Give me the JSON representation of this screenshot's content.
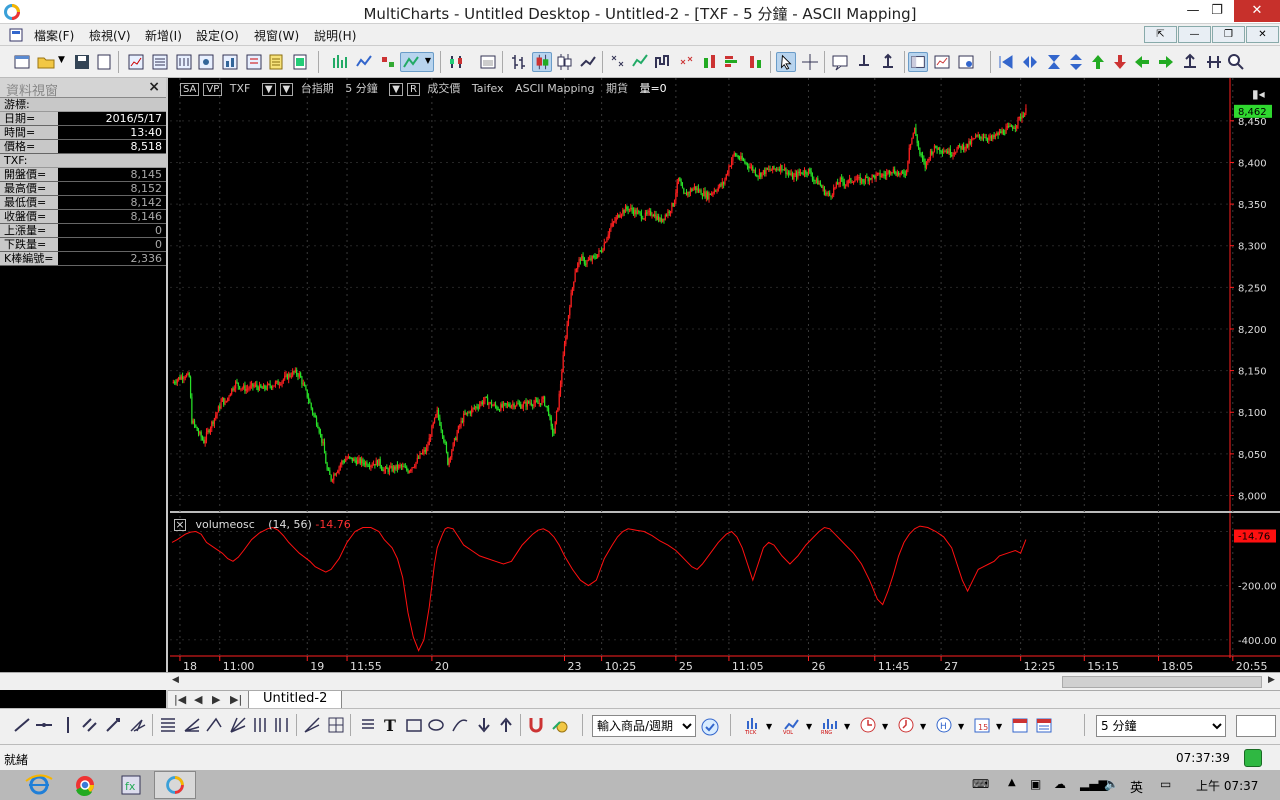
{
  "window": {
    "title": "MultiCharts - Untitled Desktop - Untitled-2 - [TXF - 5 分鐘 - ASCII Mapping]",
    "minimize": "—",
    "maximize": "❐",
    "close": "✕"
  },
  "menu": {
    "items": [
      "檔案(F)",
      "檢視(V)",
      "新增(I)",
      "設定(O)",
      "視窗(W)",
      "說明(H)"
    ]
  },
  "dataview": {
    "title": "資料視窗",
    "close": "×",
    "cursor_group": "游標:",
    "cursor_rows": [
      {
        "k": "日期=",
        "v": "2016/5/17"
      },
      {
        "k": "時間=",
        "v": "13:40"
      },
      {
        "k": "價格=",
        "v": "8,518"
      }
    ],
    "symbol_group": "TXF:",
    "symbol_rows": [
      {
        "k": "開盤價=",
        "v": "8,145"
      },
      {
        "k": "最高價=",
        "v": "8,152"
      },
      {
        "k": "最低價=",
        "v": "8,142"
      },
      {
        "k": "收盤價=",
        "v": "8,146"
      },
      {
        "k": "上漲量=",
        "v": "0"
      },
      {
        "k": "下跌量=",
        "v": "0"
      },
      {
        "k": "K棒編號=",
        "v": "2,336"
      }
    ]
  },
  "chart_header": {
    "sa": "SA",
    "vp": "VP",
    "symbol": "TXF",
    "exchange_name": "台指期",
    "resolution": "5 分鐘",
    "r_label": "R",
    "field": "成交價",
    "source": "Taifex",
    "mapping": "ASCII Mapping",
    "category": "期貨",
    "volume": "量=0"
  },
  "indicator": {
    "close": "×",
    "name": "volumeosc",
    "params": "(14, 56)",
    "value": "-14.76"
  },
  "chart_data": [
    {
      "type": "candlestick",
      "price_axis": {
        "ticks": [
          8000,
          8050,
          8100,
          8150,
          8200,
          8250,
          8300,
          8350,
          8400,
          8450
        ],
        "labels": [
          "8,000",
          "8,050",
          "8,100",
          "8,150",
          "8,200",
          "8,250",
          "8,300",
          "8,350",
          "8,400",
          "8,450"
        ],
        "ylim": [
          7985,
          8475
        ]
      },
      "last_price_label": "8,462",
      "up_color": "#ff2020",
      "down_color": "#28e028",
      "path": [
        [
          0,
          8135
        ],
        [
          4,
          8140
        ],
        [
          10,
          8145
        ],
        [
          13,
          8142
        ],
        [
          15,
          8090
        ],
        [
          20,
          8075
        ],
        [
          24,
          8065
        ],
        [
          28,
          8080
        ],
        [
          34,
          8100
        ],
        [
          38,
          8115
        ],
        [
          40,
          8110
        ],
        [
          44,
          8125
        ],
        [
          48,
          8135
        ],
        [
          52,
          8130
        ],
        [
          56,
          8128
        ],
        [
          62,
          8132
        ],
        [
          68,
          8128
        ],
        [
          74,
          8132
        ],
        [
          80,
          8135
        ],
        [
          86,
          8142
        ],
        [
          92,
          8148
        ],
        [
          96,
          8145
        ],
        [
          102,
          8120
        ],
        [
          106,
          8100
        ],
        [
          110,
          8085
        ],
        [
          114,
          8060
        ],
        [
          117,
          8030
        ],
        [
          120,
          8020
        ],
        [
          124,
          8030
        ],
        [
          128,
          8040
        ],
        [
          132,
          8045
        ],
        [
          138,
          8042
        ],
        [
          144,
          8040
        ],
        [
          150,
          8038
        ],
        [
          156,
          8040
        ],
        [
          160,
          8030
        ],
        [
          166,
          8032
        ],
        [
          172,
          8035
        ],
        [
          178,
          8030
        ],
        [
          184,
          8040
        ],
        [
          188,
          8050
        ],
        [
          192,
          8055
        ],
        [
          196,
          8080
        ],
        [
          200,
          8100
        ],
        [
          204,
          8075
        ],
        [
          206,
          8060
        ],
        [
          208,
          8040
        ],
        [
          212,
          8060
        ],
        [
          216,
          8080
        ],
        [
          220,
          8095
        ],
        [
          224,
          8100
        ],
        [
          228,
          8105
        ],
        [
          232,
          8110
        ],
        [
          236,
          8115
        ],
        [
          240,
          8110
        ],
        [
          246,
          8105
        ],
        [
          252,
          8108
        ],
        [
          258,
          8110
        ],
        [
          264,
          8108
        ],
        [
          270,
          8112
        ],
        [
          276,
          8110
        ],
        [
          280,
          8115
        ],
        [
          284,
          8100
        ],
        [
          286,
          8080
        ],
        [
          288,
          8075
        ],
        [
          292,
          8120
        ],
        [
          296,
          8180
        ],
        [
          300,
          8230
        ],
        [
          304,
          8270
        ],
        [
          308,
          8285
        ],
        [
          312,
          8280
        ],
        [
          318,
          8285
        ],
        [
          324,
          8295
        ],
        [
          330,
          8320
        ],
        [
          334,
          8330
        ],
        [
          338,
          8340
        ],
        [
          344,
          8345
        ],
        [
          350,
          8340
        ],
        [
          356,
          8335
        ],
        [
          362,
          8340
        ],
        [
          368,
          8330
        ],
        [
          374,
          8340
        ],
        [
          378,
          8350
        ],
        [
          382,
          8380
        ],
        [
          386,
          8360
        ],
        [
          390,
          8365
        ],
        [
          394,
          8370
        ],
        [
          398,
          8365
        ],
        [
          404,
          8360
        ],
        [
          410,
          8368
        ],
        [
          416,
          8375
        ],
        [
          420,
          8395
        ],
        [
          424,
          8410
        ],
        [
          428,
          8405
        ],
        [
          432,
          8400
        ],
        [
          436,
          8395
        ],
        [
          442,
          8385
        ],
        [
          448,
          8390
        ],
        [
          454,
          8392
        ],
        [
          460,
          8395
        ],
        [
          464,
          8388
        ],
        [
          468,
          8382
        ],
        [
          474,
          8388
        ],
        [
          480,
          8390
        ],
        [
          484,
          8380
        ],
        [
          488,
          8375
        ],
        [
          492,
          8365
        ],
        [
          496,
          8360
        ],
        [
          500,
          8370
        ],
        [
          504,
          8378
        ],
        [
          508,
          8375
        ],
        [
          514,
          8380
        ],
        [
          520,
          8378
        ],
        [
          526,
          8382
        ],
        [
          532,
          8384
        ],
        [
          538,
          8385
        ],
        [
          542,
          8392
        ],
        [
          546,
          8388
        ],
        [
          550,
          8385
        ],
        [
          554,
          8390
        ],
        [
          556,
          8420
        ],
        [
          560,
          8440
        ],
        [
          564,
          8410
        ],
        [
          568,
          8395
        ],
        [
          572,
          8412
        ],
        [
          576,
          8418
        ],
        [
          582,
          8415
        ],
        [
          588,
          8412
        ],
        [
          594,
          8418
        ],
        [
          600,
          8420
        ],
        [
          606,
          8430
        ],
        [
          612,
          8432
        ],
        [
          618,
          8428
        ],
        [
          624,
          8435
        ],
        [
          630,
          8440
        ],
        [
          636,
          8445
        ],
        [
          640,
          8455
        ],
        [
          644,
          8462
        ]
      ],
      "n_bars": 645
    },
    {
      "type": "line",
      "name": "volumeosc",
      "color": "#ff1010",
      "y_axis": {
        "ticks": [
          0,
          -200,
          -400
        ],
        "labels": [
          "0",
          "-200.00",
          "-400.00"
        ],
        "ylim": [
          -460,
          50
        ]
      },
      "last_value_label": "-14.76",
      "x": [
        0,
        4,
        10,
        14,
        18,
        22,
        26,
        32,
        38,
        42,
        46,
        50,
        54,
        60,
        66,
        72,
        76,
        80,
        84,
        88,
        92,
        96,
        100,
        104,
        108,
        112,
        116,
        120,
        126,
        132,
        138,
        144,
        150,
        156,
        160,
        166,
        170,
        174,
        178,
        182,
        186,
        190,
        194,
        198,
        200,
        204,
        206,
        208,
        212,
        216,
        220,
        226,
        232,
        238,
        244,
        250,
        256,
        260,
        264,
        268,
        272,
        276,
        280,
        284,
        288,
        292,
        296,
        302,
        308,
        314,
        320,
        326,
        332,
        336,
        340,
        344,
        350,
        356,
        362,
        368,
        374,
        380,
        384,
        388,
        392,
        396,
        400,
        406,
        412,
        418,
        422,
        426,
        430,
        434,
        438,
        442,
        446,
        450,
        454,
        460,
        466,
        472,
        478,
        484,
        488,
        492,
        496,
        500,
        504,
        508,
        514,
        520,
        526,
        532,
        536,
        540,
        544,
        548,
        552,
        556,
        560,
        564,
        570,
        576,
        582,
        588,
        592,
        596,
        600,
        604,
        608,
        612,
        616,
        620,
        624,
        630,
        636,
        640,
        644
      ],
      "y": [
        -40,
        -30,
        -10,
        -2,
        0,
        -10,
        -40,
        -60,
        -80,
        -100,
        -110,
        -95,
        -70,
        -30,
        -5,
        10,
        15,
        5,
        -15,
        -40,
        -60,
        -80,
        -95,
        -110,
        -130,
        -140,
        -150,
        -140,
        -100,
        -40,
        0,
        15,
        15,
        0,
        -30,
        -60,
        -100,
        -170,
        -300,
        -390,
        -440,
        -400,
        -280,
        -120,
        -60,
        -10,
        10,
        15,
        10,
        -20,
        -50,
        -70,
        -90,
        -100,
        -110,
        -120,
        -110,
        -80,
        -50,
        -30,
        -10,
        5,
        10,
        0,
        -20,
        -50,
        -90,
        -140,
        -180,
        -200,
        -180,
        -100,
        -50,
        -20,
        0,
        10,
        5,
        0,
        -15,
        -35,
        -50,
        -70,
        -90,
        -110,
        -130,
        -140,
        -120,
        -80,
        -40,
        -10,
        0,
        -20,
        -60,
        -120,
        -180,
        -120,
        -60,
        -40,
        -50,
        -90,
        -120,
        -90,
        -50,
        -20,
        0,
        15,
        10,
        -10,
        -30,
        -50,
        -80,
        -120,
        -180,
        -250,
        -270,
        -220,
        -160,
        -90,
        -40,
        -10,
        10,
        20,
        15,
        0,
        -20,
        -60,
        -120,
        -180,
        -220,
        -180,
        -140,
        -130,
        -120,
        -110,
        -90,
        -80,
        -70,
        -80,
        -30,
        -14.76
      ]
    }
  ],
  "x_axis": {
    "labels": [
      {
        "i": 6,
        "t": "18"
      },
      {
        "i": 36,
        "t": "11:00"
      },
      {
        "i": 102,
        "t": "19"
      },
      {
        "i": 132,
        "t": "11:55"
      },
      {
        "i": 196,
        "t": "20"
      },
      {
        "i": 296,
        "t": "23"
      },
      {
        "i": 324,
        "t": "10:25"
      },
      {
        "i": 380,
        "t": "25"
      },
      {
        "i": 420,
        "t": "11:05"
      },
      {
        "i": 480,
        "t": "26"
      },
      {
        "i": 530,
        "t": "11:45"
      },
      {
        "i": 580,
        "t": "27"
      },
      {
        "i": 640,
        "t": "12:25"
      },
      {
        "i": 688,
        "t": "15:15"
      },
      {
        "i": 744,
        "t": "18:05"
      },
      {
        "i": 800,
        "t": "20:55"
      }
    ]
  },
  "tabs": {
    "nav": [
      "|◀",
      "◀",
      "▶",
      "▶|"
    ],
    "active_tab": "Untitled-2"
  },
  "toolbar2": {
    "symbol_combo": "輸入商品/週期",
    "resolution_combo": "5 分鐘"
  },
  "status": {
    "ready": "就緒",
    "time": "07:37:39"
  },
  "taskbar": {
    "ime": "英",
    "clock": "上午 07:37"
  }
}
